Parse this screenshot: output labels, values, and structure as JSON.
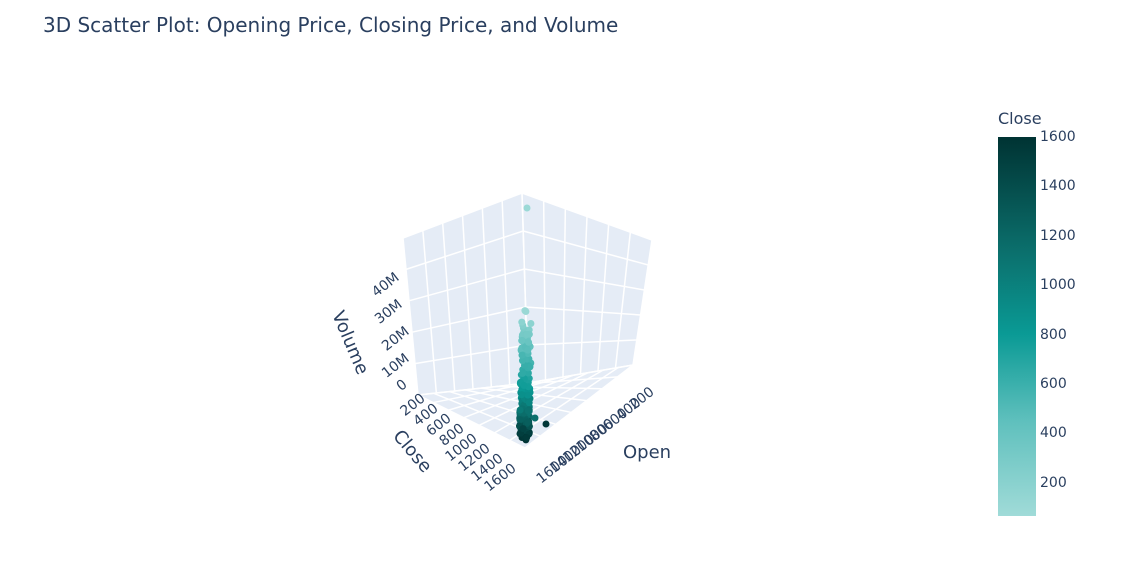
{
  "chart_data": {
    "type": "scatter3d",
    "title": "3D Scatter Plot: Opening Price, Closing Price, and Volume",
    "axes": {
      "x": {
        "label": "Open",
        "ticks": [
          "200",
          "400",
          "600",
          "800",
          "1000",
          "1200",
          "1400",
          "1600"
        ],
        "range": [
          80,
          1700
        ]
      },
      "y": {
        "label": "Close",
        "ticks": [
          "200",
          "400",
          "600",
          "800",
          "1000",
          "1200",
          "1400",
          "1600"
        ],
        "range": [
          80,
          1700
        ]
      },
      "z": {
        "label": "Volume",
        "ticks": [
          "0",
          "10M",
          "20M",
          "30M",
          "40M"
        ],
        "range": [
          0,
          46000000
        ]
      }
    },
    "colorbar": {
      "title": "Close",
      "ticks": [
        "1600",
        "1400",
        "1200",
        "1000",
        "800",
        "600",
        "400",
        "200"
      ],
      "range": [
        65,
        1600
      ]
    },
    "points_sample": [
      {
        "open": 100,
        "close": 100,
        "volume": 45000000
      },
      {
        "open": 180,
        "close": 175,
        "volume": 25000000
      },
      {
        "open": 260,
        "close": 255,
        "volume": 20000000
      },
      {
        "open": 350,
        "close": 348,
        "volume": 16000000
      },
      {
        "open": 450,
        "close": 450,
        "volume": 13000000
      },
      {
        "open": 560,
        "close": 555,
        "volume": 11000000
      },
      {
        "open": 650,
        "close": 650,
        "volume": 9000000
      },
      {
        "open": 760,
        "close": 758,
        "volume": 8000000
      },
      {
        "open": 860,
        "close": 860,
        "volume": 7000000
      },
      {
        "open": 950,
        "close": 948,
        "volume": 6000000
      },
      {
        "open": 1050,
        "close": 1050,
        "volume": 5000000
      },
      {
        "open": 1150,
        "close": 1152,
        "volume": 4000000
      },
      {
        "open": 1250,
        "close": 1245,
        "volume": 3500000
      },
      {
        "open": 1350,
        "close": 1352,
        "volume": 3000000
      },
      {
        "open": 1450,
        "close": 1448,
        "volume": 2500000
      },
      {
        "open": 1500,
        "close": 1600,
        "volume": 2000000
      }
    ],
    "grid": true
  }
}
